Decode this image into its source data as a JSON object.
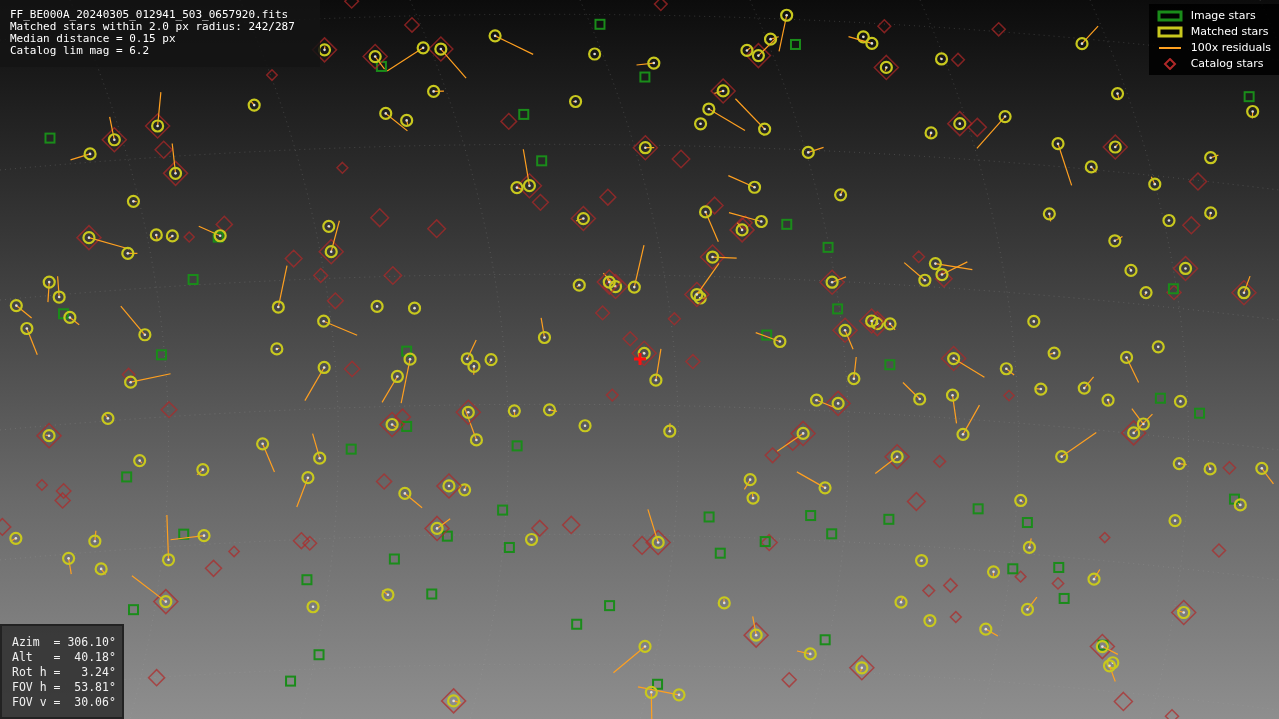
{
  "header": {
    "lines": [
      "FF_BE000A_20240305_012941_503_0657920.fits",
      "Matched stars within 2.0 px radius: 242/287",
      "Median distance = 0.15 px",
      "Catalog lim mag = 6.2"
    ]
  },
  "legend": [
    {
      "kind": "box",
      "color": "#1a8c1a",
      "label": "Image stars"
    },
    {
      "kind": "box",
      "color": "#c8c81e",
      "label": "Matched stars"
    },
    {
      "kind": "line",
      "color": "#ffa020",
      "label": "100x residuals"
    },
    {
      "kind": "diamond",
      "color": "#b02828",
      "label": "Catalog stars"
    }
  ],
  "pointing": {
    "lines": [
      "Azim  = 306.10°",
      "Alt   =  40.18°",
      "Rot h =   3.24°",
      "FOV h =  53.81°",
      "FOV v =  30.06°"
    ]
  }
}
